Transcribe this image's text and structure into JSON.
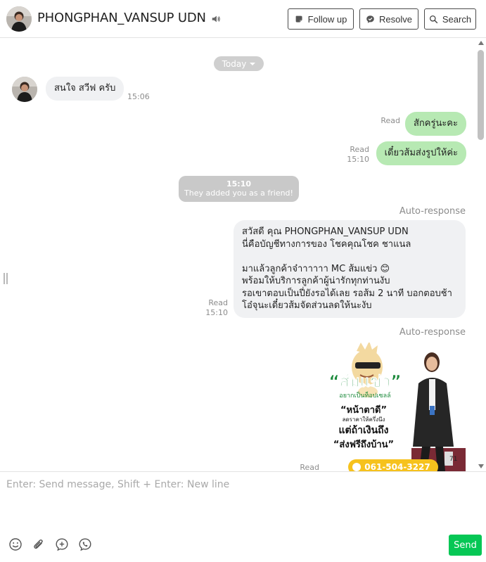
{
  "header": {
    "contact_name": "PHONGPHAN_VANSUP UDN",
    "follow_up_label": "Follow up",
    "resolve_label": "Resolve",
    "search_label": "Search"
  },
  "chat": {
    "date_label": "Today",
    "messages": [
      {
        "direction": "in",
        "text": "สนใจ สวีฟ ครับ",
        "time": "15:06"
      },
      {
        "direction": "out",
        "text": "สักครู่นะคะ",
        "status": "Read"
      },
      {
        "direction": "out",
        "text": "เดี๋ยวส้มส่งรูปให้ค่ะ",
        "status": "Read",
        "time": "15:10"
      },
      {
        "direction": "out",
        "status": "Read",
        "time": "15:10",
        "label": "Auto-response",
        "text": "สวัสดี คุณ PHONGPHAN_VANSUP UDN\nนี่คือบัญชีทางการของ โชคคุณโชค ชาแนล\n\nมาแล้วลูกค้าจ๋าาาาาา MC ส้มแข่ว 😊\nพร้อมให้บริการลูกค้าผู้น่ารักทุกท่านงับ\nรอเขาตอบเป็นปี่ยังรอได้เลย รอส้ม 2 นาที บอกตอบช้า\nโอ๋จุนะเดี๋ยวส้มจัดส่วนลดให้นะงับ"
      },
      {
        "direction": "out",
        "type": "image",
        "status": "Read",
        "label": "Auto-response"
      }
    ],
    "system_notice": {
      "time": "15:10",
      "text": "They added you as a friend!"
    }
  },
  "promo": {
    "title": "“ส้มแข่ว”",
    "subtitle": "อยากเป็นท็อปเซลล์",
    "line1": "“หน้าตาดี”",
    "line2": "ลดราคาให้ครึ่งนึง",
    "line3": "แต่ถ้าเงินถึง",
    "line4": "“ส่งฟรีถึงบ้าน”",
    "phone": "061-504-3227",
    "badge": "71"
  },
  "composer": {
    "placeholder": "Enter: Send message, Shift + Enter: New line",
    "send_label": "Send"
  },
  "colors": {
    "accent_green": "#06c755",
    "outgoing_bubble": "#b7e9b3",
    "incoming_bubble": "#f0f1f3",
    "system_notice_bg": "#c9c9c9"
  },
  "icons": [
    "speaker-icon",
    "follow-up-icon",
    "resolve-icon",
    "search-icon",
    "emoji-icon",
    "attachment-icon",
    "add-icon",
    "phone-icon"
  ]
}
